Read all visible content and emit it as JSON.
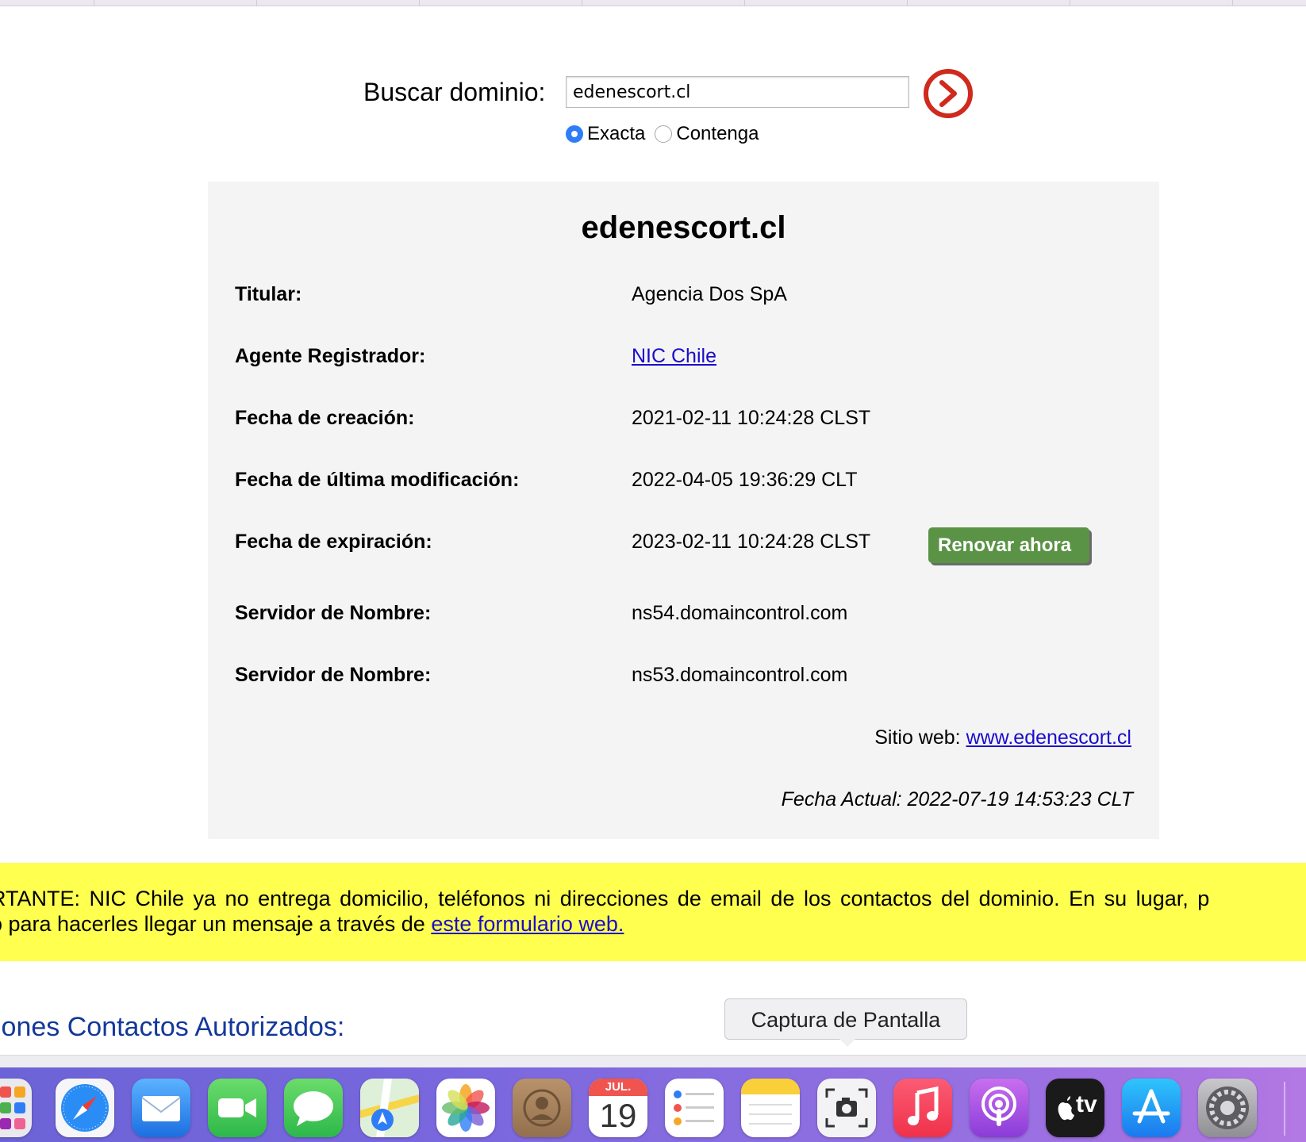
{
  "search": {
    "label": "Buscar dominio:",
    "value": "edenescort.cl",
    "options": [
      {
        "label": "Exacta",
        "checked": true
      },
      {
        "label": "Contenga",
        "checked": false
      }
    ]
  },
  "result": {
    "domain": "edenescort.cl",
    "rows": [
      {
        "label": "Titular:",
        "value": "Agencia Dos SpA"
      },
      {
        "label": "Agente Registrador:",
        "value": "NIC Chile"
      },
      {
        "label": "Fecha de creación:",
        "value": "2021-02-11 10:24:28 CLST"
      },
      {
        "label": "Fecha de última modificación:",
        "value": "2022-04-05 19:36:29 CLT"
      },
      {
        "label": "Fecha de expiración:",
        "value": "2023-02-11 10:24:28 CLST"
      },
      {
        "label": "Servidor de Nombre:",
        "value": "ns54.domaincontrol.com"
      },
      {
        "label": "Servidor de Nombre:",
        "value": "ns53.domaincontrol.com"
      }
    ],
    "renew_label": "Renovar ahora",
    "website_label": "Sitio web: ",
    "website_url": "www.edenescort.cl",
    "current_date": "Fecha Actual: 2022-07-19 14:53:23 CLT"
  },
  "notice": {
    "line1": "RTANTE: NIC Chile ya no entrega domicilio, teléfonos ni direcciones de email de los contactos del dominio. En su lugar, p",
    "line2_prefix": "o para hacerles llegar un mensaje a través de ",
    "link": "este formulario web."
  },
  "contacts_heading": "iones Contactos Autorizados:",
  "tooltip": "Captura de Pantalla",
  "dock": {
    "calendar_month": "JUL.",
    "calendar_day": "19",
    "tv_label": "tv",
    "colors": {
      "accent": "#2f7df6",
      "renew": "#5a9345",
      "notice_bg": "#ffff4f",
      "go_button": "#cf2a1d"
    },
    "items": [
      "launchpad-icon",
      "safari-icon",
      "mail-icon",
      "facetime-icon",
      "messages-icon",
      "maps-icon",
      "photos-icon",
      "contacts-icon",
      "calendar-icon",
      "reminders-icon",
      "notes-icon",
      "screenshot-icon",
      "music-icon",
      "podcasts-icon",
      "apple-tv-icon",
      "app-store-icon",
      "system-preferences-icon"
    ]
  }
}
